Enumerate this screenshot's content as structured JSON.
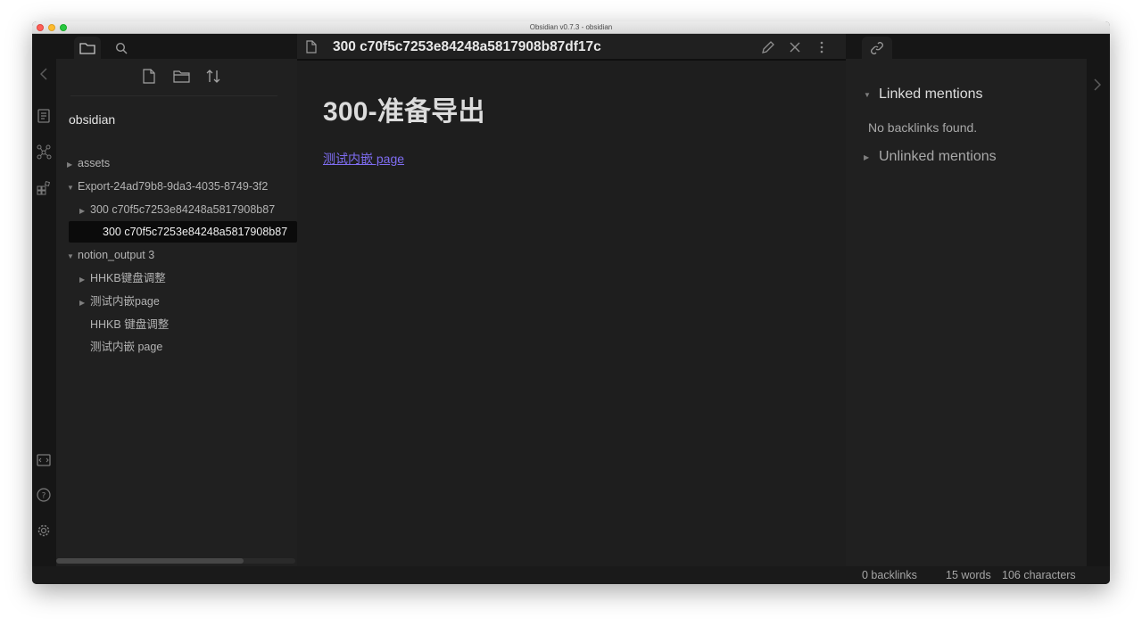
{
  "window": {
    "title": "Obsidian v0.7.3 - obsidian"
  },
  "ribbon": {
    "icons": [
      "open-note-icon",
      "graph-view-icon",
      "plugins-icon",
      "command-palette-icon",
      "help-icon",
      "settings-icon"
    ]
  },
  "left_sidebar": {
    "tabs": [
      "file-explorer-icon",
      "search-icon"
    ],
    "actions": [
      "new-note-icon",
      "new-folder-icon",
      "sort-icon"
    ],
    "vault_name": "obsidian",
    "tree": [
      {
        "label": "assets",
        "type": "folder",
        "expanded": false,
        "level": 0
      },
      {
        "label": "Export-24ad79b8-9da3-4035-8749-3f2",
        "type": "folder",
        "expanded": true,
        "level": 0
      },
      {
        "label": "300 c70f5c7253e84248a5817908b87",
        "type": "folder",
        "expanded": false,
        "level": 1
      },
      {
        "label": "300 c70f5c7253e84248a5817908b87",
        "type": "file",
        "active": true,
        "level": 1
      },
      {
        "label": "notion_output 3",
        "type": "folder",
        "expanded": true,
        "level": 0
      },
      {
        "label": "HHKB键盘调整",
        "type": "folder",
        "expanded": false,
        "level": 1
      },
      {
        "label": "测试内嵌page",
        "type": "folder",
        "expanded": false,
        "level": 1
      },
      {
        "label": "HHKB 键盘调整",
        "type": "file",
        "level": 1
      },
      {
        "label": "测试内嵌 page",
        "type": "file",
        "level": 1
      }
    ]
  },
  "editor": {
    "title": "300 c70f5c7253e84248a5817908b87df17c",
    "heading": "300-准备导出",
    "link": "测试内嵌 page",
    "actions": [
      "edit-icon",
      "close-icon",
      "more-icon"
    ]
  },
  "right_sidebar": {
    "tab": "link-icon",
    "linked_title": "Linked mentions",
    "no_backlinks": "No backlinks found.",
    "unlinked_title": "Unlinked mentions"
  },
  "status_bar": {
    "backlinks": "0 backlinks",
    "words": "15 words",
    "characters": "106 characters"
  },
  "colors": {
    "accent_link": "#7f6df2",
    "background": "#1e1e1e",
    "sidebar": "#202020"
  }
}
